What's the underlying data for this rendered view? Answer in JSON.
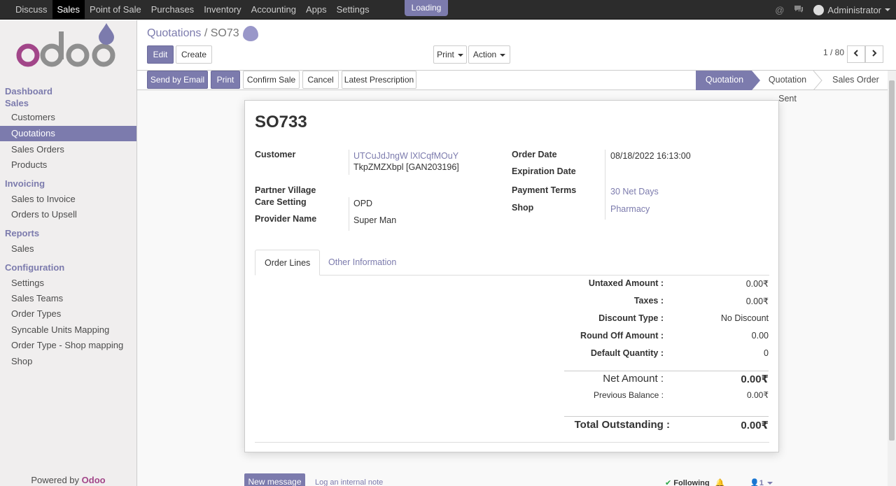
{
  "topbar": {
    "menu": [
      "Discuss",
      "Sales",
      "Point of Sale",
      "Purchases",
      "Inventory",
      "Accounting",
      "Apps",
      "Settings"
    ],
    "active_menu": "Sales",
    "loading": "Loading",
    "user": "Administrator"
  },
  "sidebar": {
    "dashboard": "Dashboard",
    "sales_section": "Sales",
    "sales_items": [
      "Customers",
      "Quotations",
      "Sales Orders",
      "Products"
    ],
    "invoicing_section": "Invoicing",
    "invoicing_items": [
      "Sales to Invoice",
      "Orders to Upsell"
    ],
    "reports_section": "Reports",
    "reports_items": [
      "Sales"
    ],
    "configuration_section": "Configuration",
    "configuration_items": [
      "Settings",
      "Sales Teams",
      "Order Types",
      "Syncable Units Mapping",
      "Order Type - Shop mapping",
      "Shop"
    ],
    "powered_by": "Powered by",
    "powered_brand": "Odoo"
  },
  "control_panel": {
    "breadcrumb_parent": "Quotations",
    "breadcrumb_sep": "/",
    "breadcrumb_current": "SO73",
    "edit": "Edit",
    "create": "Create",
    "print": "Print",
    "action": "Action",
    "pager": "1 / 80"
  },
  "status_bar": {
    "buttons": [
      "Send by Email",
      "Print",
      "Confirm Sale",
      "Cancel",
      "Latest Prescription"
    ],
    "stages": [
      "Quotation",
      "Quotation Sent",
      "Sales Order"
    ],
    "active_stage": "Quotation"
  },
  "form": {
    "name": "SO733",
    "customer_label": "Customer",
    "customer_name": "UTCuJdJngW lXlCqfMOuY",
    "customer_detail": "TkpZMZXbpl [GAN203196]",
    "partner_village_label": "Partner Village",
    "care_setting_label": "Care Setting",
    "care_setting": "OPD",
    "provider_label": "Provider Name",
    "provider": "Super Man",
    "order_date_label": "Order Date",
    "order_date": "08/18/2022 16:13:00",
    "expiration_label": "Expiration Date",
    "payment_terms_label": "Payment Terms",
    "payment_terms": "30 Net Days",
    "shop_label": "Shop",
    "shop": "Pharmacy"
  },
  "tabs": [
    "Order Lines",
    "Other Information"
  ],
  "totals": {
    "untaxed_label": "Untaxed Amount :",
    "untaxed": "0.00₹",
    "taxes_label": "Taxes :",
    "taxes": "0.00₹",
    "discount_type_label": "Discount Type :",
    "discount_type": "No Discount",
    "round_off_label": "Round Off Amount :",
    "round_off": "0.00",
    "default_qty_label": "Default Quantity :",
    "default_qty": "0",
    "net_label": "Net Amount :",
    "net": "0.00₹",
    "prev_balance_label": "Previous Balance :",
    "prev_balance": "0.00₹",
    "total_outstanding_label": "Total Outstanding :",
    "total_outstanding": "0.00₹"
  },
  "chatter": {
    "new_message": "New message",
    "log_note": "Log an internal note",
    "following": "Following",
    "followers": "1"
  },
  "colors": {
    "brand": "#7c7bad",
    "topbar": "#2c2c2c",
    "logo_pink": "#a24689",
    "logo_grey": "#8f8f8f"
  }
}
